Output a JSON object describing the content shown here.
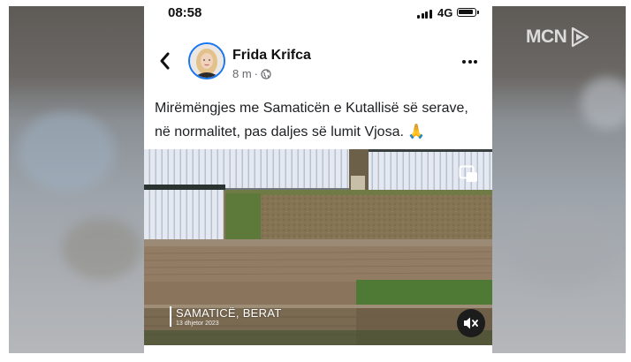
{
  "status_bar": {
    "time": "08:58",
    "network": "4G"
  },
  "watermark": {
    "text": "MCN"
  },
  "post": {
    "author": "Frida Krifca",
    "time": "8 m",
    "separator": "·",
    "caption_line1": "Mirëmëngjes me Samaticën e Kutallisë së serave,",
    "caption_line2": "në normalitet, pas daljes së lumit Vjosa.",
    "caption_emoji": "🙏"
  },
  "video": {
    "location": "SAMATICË, BERAT",
    "date": "13 dhjetor 2023"
  },
  "icons": {
    "back": "chevron-left-icon",
    "privacy": "globe-icon",
    "more": "more-dots-icon",
    "pip": "picture-in-picture-icon",
    "mute": "speaker-muted-icon",
    "watermark_logo": "play-logo-icon"
  },
  "colors": {
    "avatar_ring": "#1877f2",
    "secondary_text": "#65676b",
    "greenhouse": "#dfe4ee",
    "field_soil": "#8f7a62"
  }
}
